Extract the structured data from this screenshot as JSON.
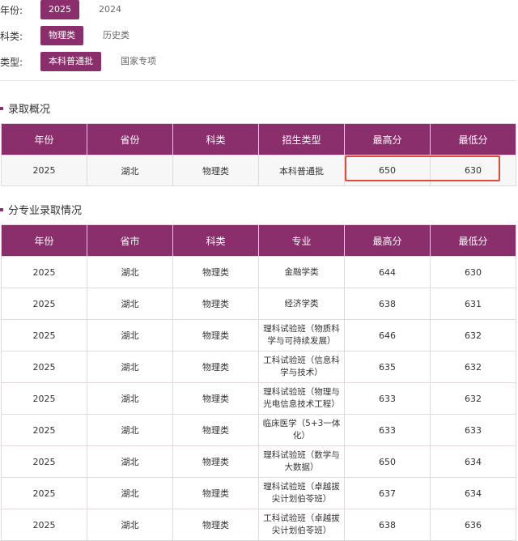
{
  "filters": {
    "year": {
      "label": "年份:",
      "options": [
        "2025",
        "2024"
      ],
      "selected": "2025"
    },
    "category": {
      "label": "科类:",
      "options": [
        "物理类",
        "历史类"
      ],
      "selected": "物理类"
    },
    "type": {
      "label": "类型:",
      "options": [
        "本科普通批",
        "国家专项"
      ],
      "selected": "本科普通批"
    }
  },
  "overview": {
    "title": "录取概况",
    "headers": [
      "年份",
      "省份",
      "科类",
      "招生类型",
      "最高分",
      "最低分"
    ],
    "row": [
      "2025",
      "湖北",
      "物理类",
      "本科普通批",
      "650",
      "630"
    ]
  },
  "majors": {
    "title": "分专业录取情况",
    "headers": [
      "年份",
      "省市",
      "科类",
      "专业",
      "最高分",
      "最低分"
    ],
    "rows": [
      [
        "2025",
        "湖北",
        "物理类",
        "金融学类",
        "644",
        "630"
      ],
      [
        "2025",
        "湖北",
        "物理类",
        "经济学类",
        "638",
        "631"
      ],
      [
        "2025",
        "湖北",
        "物理类",
        "理科试验班（物质科学与可持续发展）",
        "646",
        "632"
      ],
      [
        "2025",
        "湖北",
        "物理类",
        "工科试验班（信息科学与技术）",
        "635",
        "632"
      ],
      [
        "2025",
        "湖北",
        "物理类",
        "理科试验班（物理与光电信息技术工程）",
        "633",
        "632"
      ],
      [
        "2025",
        "湖北",
        "物理类",
        "临床医学（5+3一体化）",
        "633",
        "633"
      ],
      [
        "2025",
        "湖北",
        "物理类",
        "理科试验班（数学与大数据）",
        "650",
        "634"
      ],
      [
        "2025",
        "湖北",
        "物理类",
        "理科试验班（卓越拔尖计划伯苓班）",
        "637",
        "634"
      ],
      [
        "2025",
        "湖北",
        "物理类",
        "工科试验班（卓越拔尖计划伯苓班）",
        "638",
        "636"
      ]
    ]
  },
  "colors": {
    "accent": "#8a2f6b",
    "highlight": "#e04a3a"
  }
}
